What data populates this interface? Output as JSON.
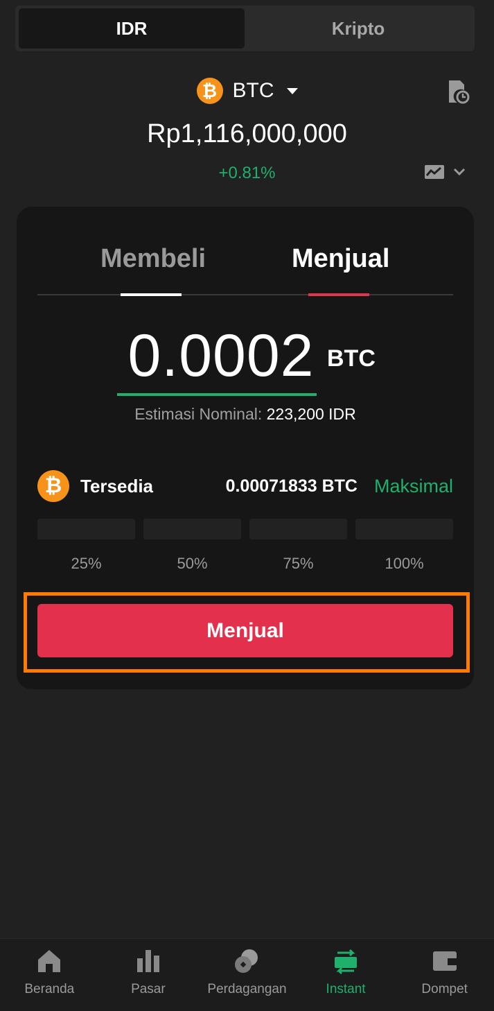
{
  "currency_toggle": {
    "idr": "IDR",
    "crypto": "Kripto",
    "selected": "IDR"
  },
  "coin": {
    "icon": "bitcoin-icon",
    "symbol": "BTC",
    "badge": "₿"
  },
  "price": "Rp1,116,000,000",
  "change": "+0.81%",
  "trade": {
    "tab_buy": "Membeli",
    "tab_sell": "Menjual",
    "active_tab": "Menjual",
    "amount": "0.0002",
    "amount_unit": "BTC",
    "estimate_label": "Estimasi Nominal:",
    "estimate_value": "223,200 IDR",
    "available_label": "Tersedia",
    "available_value": "0.00071833 BTC",
    "max_label": "Maksimal",
    "percentages": [
      "25%",
      "50%",
      "75%",
      "100%"
    ],
    "submit_label": "Menjual"
  },
  "colors": {
    "accent_green": "#1fb06c",
    "sell_red": "#e3314d",
    "highlight": "#ff7a00",
    "btc_orange": "#f7931a"
  },
  "nav": [
    {
      "label": "Beranda",
      "icon": "home-icon"
    },
    {
      "label": "Pasar",
      "icon": "market-icon"
    },
    {
      "label": "Perdagangan",
      "icon": "trade-icon"
    },
    {
      "label": "Instant",
      "icon": "instant-icon",
      "active": true
    },
    {
      "label": "Dompet",
      "icon": "wallet-icon"
    }
  ]
}
